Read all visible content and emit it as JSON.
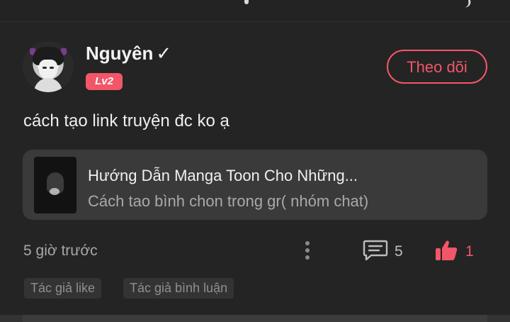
{
  "post": {
    "user": {
      "name": "Nguyên",
      "verified_mark": "✓",
      "level": "Lv2",
      "avatar": "avatar-icon"
    },
    "follow_label": "Theo dõi",
    "text": "cách tạo link truyện đc ko ạ",
    "linked_card": {
      "title": "Hướng Dẫn Manga Toon Cho Những...",
      "subtitle": "Cách tao bình chon trong gr( nhóm chat)",
      "thumbnail": "thumbnail-image"
    },
    "time": "5 giờ trước",
    "comments": "5",
    "likes": "1",
    "tags": [
      "Tác giả like",
      "Tác giả bình luận"
    ]
  },
  "colors": {
    "accent": "#f25669",
    "background": "#242424",
    "card": "#3a3a3a",
    "muted_text": "#a7a7a7"
  },
  "icons": {
    "more": "more-vertical-icon",
    "comment": "comment-icon",
    "like": "thumbs-up-icon"
  }
}
